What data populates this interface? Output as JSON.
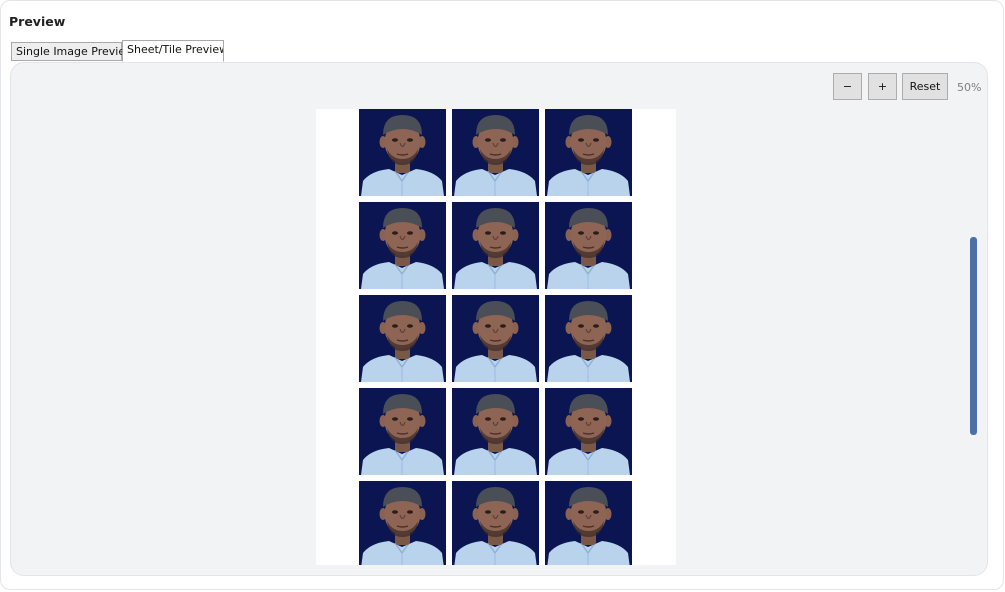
{
  "panel": {
    "title": "Preview"
  },
  "tabs": [
    {
      "label": "Single Image Preview",
      "active": false
    },
    {
      "label": "Sheet/Tile Preview",
      "active": true
    }
  ],
  "zoom": {
    "minus_label": "−",
    "plus_label": "+",
    "reset_label": "Reset",
    "level": "50%"
  },
  "sheet": {
    "rows": 5,
    "columns": 3,
    "photo_background": "#0b1552",
    "shirt_color": "#b9d3ec"
  },
  "colors": {
    "accent": "#4e6fa8"
  }
}
